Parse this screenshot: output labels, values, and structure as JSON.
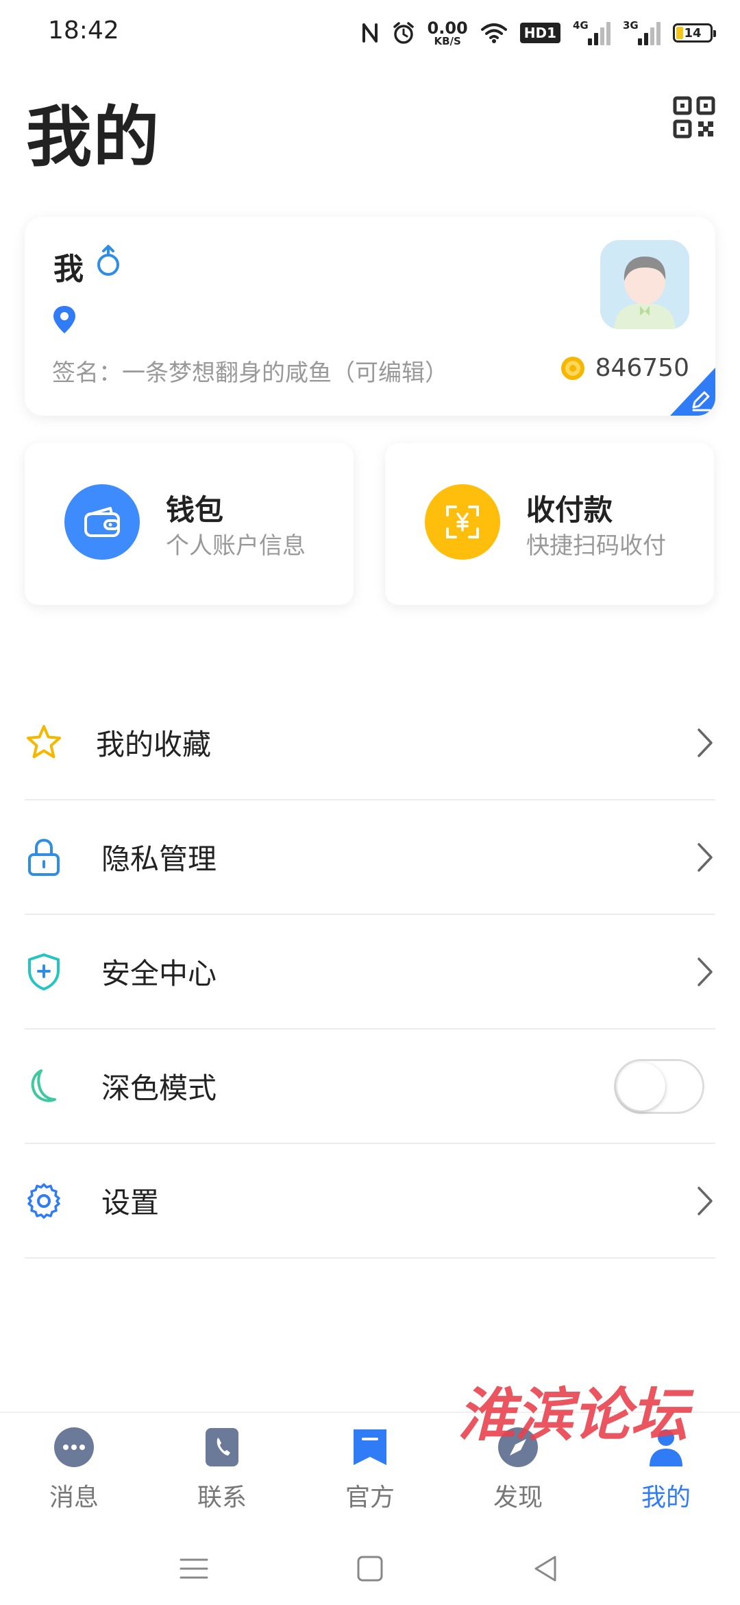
{
  "status_bar": {
    "time": "18:42",
    "net_speed_value": "0.00",
    "net_speed_unit": "KB/S",
    "hd_label": "HD1",
    "signal_1_label": "4G",
    "signal_2_label": "3G",
    "battery_level": "14",
    "icons": [
      "nfc-icon",
      "alarm-icon",
      "wifi-icon",
      "hd-icon",
      "signal-4g-icon",
      "signal-3g-icon",
      "battery-icon"
    ]
  },
  "header": {
    "title": "我的",
    "qr_icon": "qr-code-icon"
  },
  "profile": {
    "name": "我",
    "gender_icon": "male-icon",
    "location_icon": "location-pin-icon",
    "signature": "签名：一条梦想翻身的咸鱼（可编辑）",
    "coin_count": "846750",
    "edit_icon": "edit-pencil-icon"
  },
  "quick_actions": [
    {
      "title": "钱包",
      "subtitle": "个人账户信息",
      "icon": "wallet-icon",
      "color": "#3d8bfd"
    },
    {
      "title": "收付款",
      "subtitle": "快捷扫码收付",
      "icon": "scan-pay-icon",
      "color": "#ffbe0b"
    }
  ],
  "menu": {
    "items": [
      {
        "label": "我的收藏",
        "icon": "star-icon",
        "trailing": "chevron"
      },
      {
        "label": "隐私管理",
        "icon": "lock-icon",
        "trailing": "chevron"
      },
      {
        "label": "安全中心",
        "icon": "shield-icon",
        "trailing": "chevron"
      },
      {
        "label": "深色模式",
        "icon": "moon-icon",
        "trailing": "toggle",
        "toggle_on": false
      },
      {
        "label": "设置",
        "icon": "gear-icon",
        "trailing": "chevron"
      }
    ]
  },
  "bottom_nav": {
    "items": [
      {
        "label": "消息",
        "icon": "chat-bubble-icon"
      },
      {
        "label": "联系",
        "icon": "contacts-book-icon"
      },
      {
        "label": "官方",
        "icon": "official-bookmark-icon"
      },
      {
        "label": "发现",
        "icon": "compass-icon"
      },
      {
        "label": "我的",
        "icon": "person-icon",
        "active": true
      }
    ]
  },
  "watermark": {
    "text": "淮滨论坛"
  },
  "colors": {
    "accent": "#2f7cf6",
    "star": "#f5b800",
    "lock": "#2f8de4",
    "shield": "#25c4c4",
    "moon": "#3cc9a0",
    "gear": "#2f7cf6",
    "watermark": "#e8424e"
  }
}
